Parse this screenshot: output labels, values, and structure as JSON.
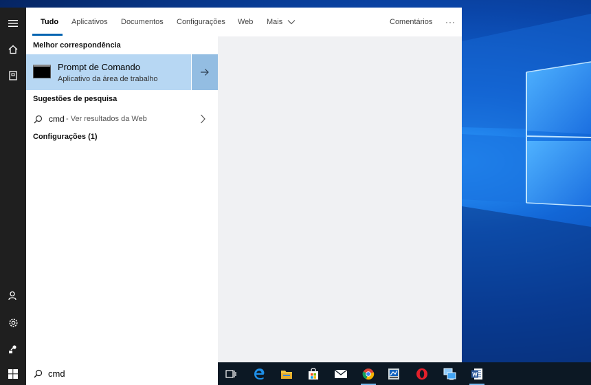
{
  "tabs": [
    {
      "label": "Tudo",
      "active": true
    },
    {
      "label": "Aplicativos"
    },
    {
      "label": "Documentos"
    },
    {
      "label": "Configurações"
    },
    {
      "label": "Web"
    },
    {
      "label": "Mais"
    }
  ],
  "header_right": {
    "feedback_label": "Comentários",
    "more_options": "···"
  },
  "results": {
    "best_match": {
      "heading": "Melhor correspondência",
      "title": "Prompt de Comando",
      "subtitle": "Aplicativo da área de trabalho"
    },
    "suggestions": {
      "heading": "Sugestões de pesquisa",
      "query": "cmd",
      "hint": "- Ver resultados da Web"
    },
    "settings": {
      "heading": "Configurações (1)"
    }
  },
  "search": {
    "value": "cmd"
  },
  "rail_icons": [
    "hamburger-icon",
    "home-icon",
    "notebook-icon",
    "person-icon",
    "gear-icon",
    "feedback-icon"
  ],
  "taskbar_icons": [
    "task-view-icon",
    "edge-icon",
    "file-explorer-icon",
    "store-icon",
    "mail-icon",
    "chrome-icon",
    "app-icon",
    "opera-icon",
    "network-app-icon",
    "word-icon"
  ],
  "colors": {
    "accent": "#0063b1",
    "selected": "#b7d7f3",
    "selected_arrow": "#93bde2",
    "rail": "#1f1f1f"
  }
}
